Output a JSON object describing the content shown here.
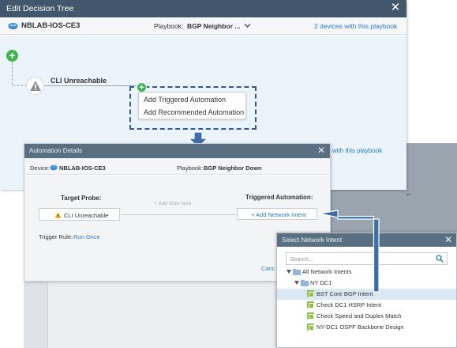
{
  "edit_decision_tree": {
    "title": "Edit Decision Tree",
    "device_name": "NBLAB-IOS-CE3",
    "playbook_label": "Playbook:",
    "playbook_value": "BGP Neighbor ...",
    "devices_link": "2 devices with this playbook",
    "devices_link_partial": "with this playbook",
    "node_label": "CLI Unreachable",
    "context_menu": [
      "Add Triggered Automation",
      "Add Recommended Automation"
    ]
  },
  "automation_details": {
    "title": "Automation Details",
    "device_label": "Device:",
    "device_value": "NBLAB-IOS-CE3",
    "playbook_label": "Playbook:",
    "playbook_value": "BGP Neighbor Down",
    "target_probe_label": "Target Probe:",
    "triggered_automation_label": "Triggered Automation:",
    "probe_value": "CLI Unreachable",
    "add_note": "+ Add Note here",
    "add_network_intent": "+ Add Network Intent",
    "trigger_rule_label": "Trigger Rule:",
    "trigger_rule_value": "Run Once",
    "cancel_partial": "Canc"
  },
  "select_network_intent": {
    "title": "Select Network Intent",
    "search_placeholder": "Search...",
    "root": "All Network Intents",
    "folder": "NY DC1",
    "items": [
      "BST Core BGP Intent",
      "Check DC1 HSRP Intent",
      "Check Speed and Duplex Match",
      "NY-DC1 OSPF Backbone Design"
    ],
    "selected_index": 0
  },
  "colors": {
    "title_bar": "#43576c",
    "dialog_title_bar": "#5b6f83",
    "link": "#2a79b8",
    "add_green": "#3cb54a",
    "arrow_blue": "#3d6ea8",
    "intent_green": "#8ec33f",
    "warning_yellow": "#f0ad1a"
  },
  "icons": [
    "close-icon",
    "device-icon",
    "chevron-down-icon",
    "plus-icon",
    "warning-icon",
    "search-icon",
    "folder-icon",
    "intent-icon",
    "arrow-down-icon",
    "arrow-left-icon"
  ]
}
